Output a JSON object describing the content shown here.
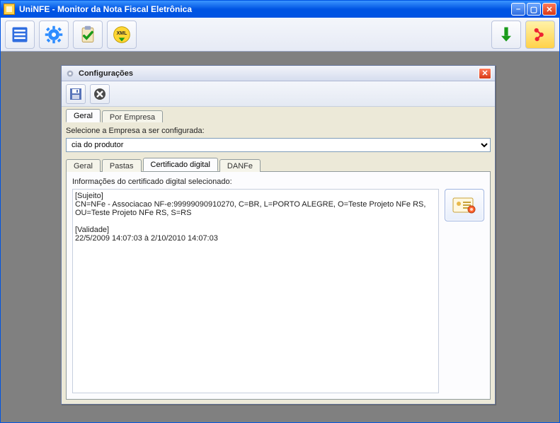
{
  "window": {
    "title": "UniNFE - Monitor da Nota Fiscal Eletrônica"
  },
  "toolbar": {
    "form_icon": "form-icon",
    "gear_icon": "gear-icon",
    "check_icon": "clipboard-check-icon",
    "xml_icon": "xml-icon",
    "download_icon": "download-icon",
    "exit_icon": "exit-icon"
  },
  "dialog": {
    "title": "Configurações",
    "outer_tabs": {
      "geral": "Geral",
      "por_empresa": "Por Empresa",
      "active": "geral"
    },
    "company_label": "Selecione a Empresa a ser configurada:",
    "company_value": "cia do produtor",
    "inner_tabs": {
      "geral": "Geral",
      "pastas": "Pastas",
      "certificado": "Certificado digital",
      "danfe": "DANFe",
      "active": "certificado"
    },
    "cert_section_label": "Informações do certificado digital selecionado:",
    "cert_text": "[Sujeito]\nCN=NFe - Associacao NF-e:99999090910270, C=BR, L=PORTO ALEGRE, O=Teste Projeto NFe RS, OU=Teste Projeto NFe RS, S=RS\n\n[Validade]\n22/5/2009 14:07:03 à 2/10/2010 14:07:03"
  }
}
